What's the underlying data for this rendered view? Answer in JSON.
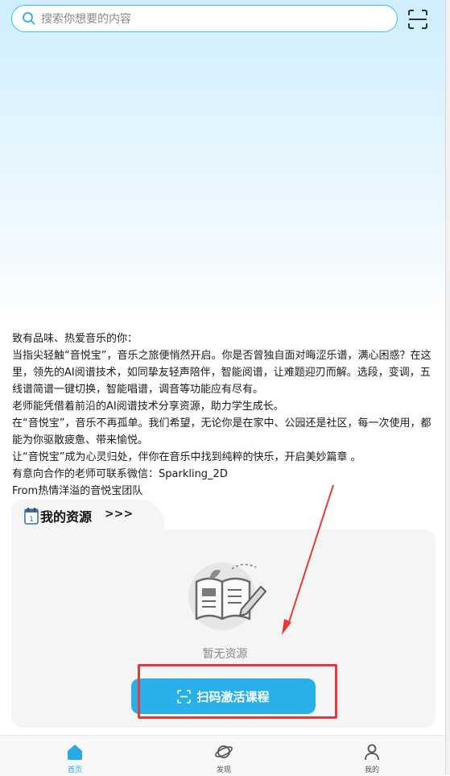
{
  "search": {
    "placeholder": "搜索你想要的内容"
  },
  "intro": {
    "lines": [
      "致有品味、热爱音乐的你：",
      "当指尖轻触“音悦宝”，音乐之旅便悄然开启。你是否曾独自面对晦涩乐谱，满心困惑？在这里，领先的AI阅谱技术，如同挚友轻声陪伴，智能阅谱，让难题迎刃而解。选段，变调，五线谱简谱一键切换，智能唱谱，调音等功能应有尽有。",
      "老师能凭借着前沿的AI阅谱技术分享资源，助力学生成长。",
      "在“音悦宝”，音乐不再孤单。我们希望，无论你是在家中、公园还是社区，每一次使用，都能为你驱散疲惫、带来愉悦。",
      "让“音悦宝”成为心灵归处，伴你在音乐中找到纯粹的快乐，开启美妙篇章 。",
      "有意向合作的老师可联系微信：Sparkling_2D",
      "From热情洋溢的音悦宝团队"
    ]
  },
  "resources": {
    "title": "我的资源",
    "more": ">>>",
    "empty_text": "暂无资源",
    "activate_label": "扫码激活课程"
  },
  "tabbar": {
    "items": [
      {
        "label": "首页",
        "icon": "home-icon",
        "active": true
      },
      {
        "label": "发现",
        "icon": "planet-icon",
        "active": false
      },
      {
        "label": "我的",
        "icon": "user-icon",
        "active": false
      }
    ]
  },
  "colors": {
    "accent": "#29b0eb",
    "search_border": "#37c0ee",
    "annotation": "#e8383b"
  }
}
